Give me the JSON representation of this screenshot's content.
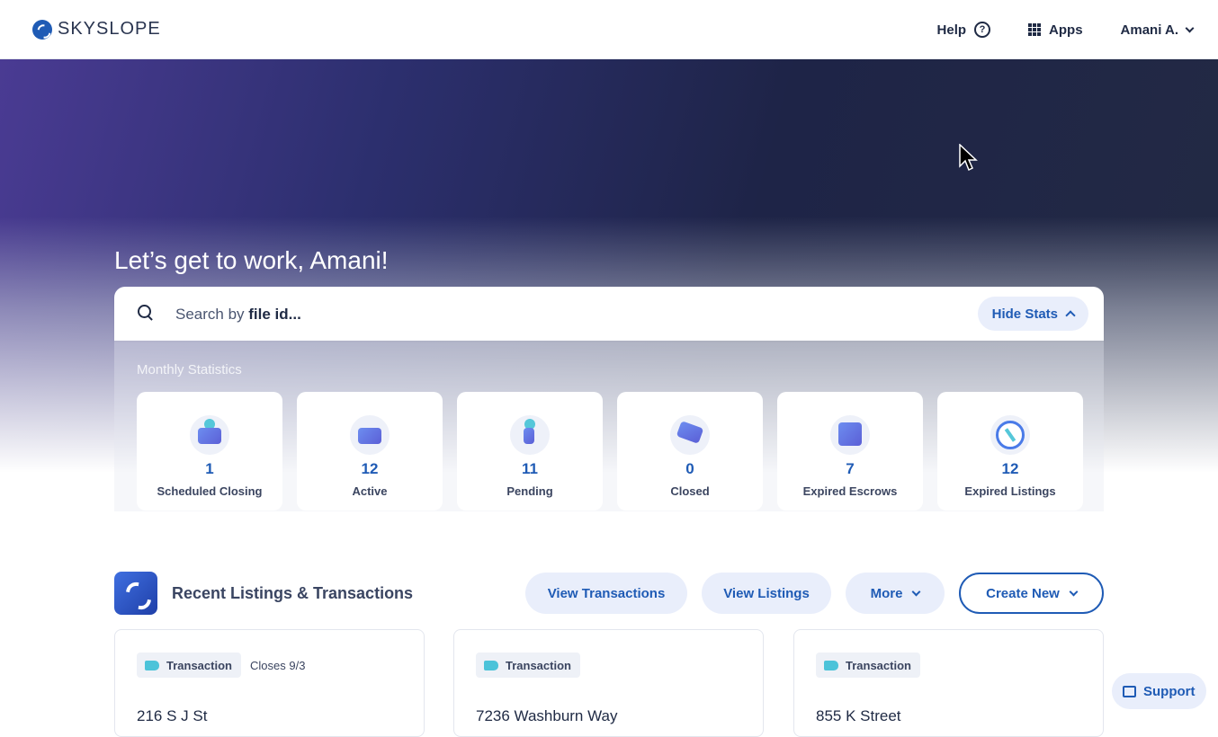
{
  "header": {
    "logo_text": "SKYSLOPE",
    "help_label": "Help",
    "apps_label": "Apps",
    "user_label": "Amani A."
  },
  "hero": {
    "greeting": "Let’s get to work, Amani!"
  },
  "search": {
    "prefix": "Search by ",
    "keyword": "file id...",
    "hide_stats_label": "Hide Stats"
  },
  "stats": {
    "title": "Monthly Statistics",
    "items": [
      {
        "value": "1",
        "label": "Scheduled Closing",
        "icon": "closing-sign-icon"
      },
      {
        "value": "12",
        "label": "Active",
        "icon": "briefcase-icon"
      },
      {
        "value": "11",
        "label": "Pending",
        "icon": "key-icon"
      },
      {
        "value": "0",
        "label": "Closed",
        "icon": "handshake-icon"
      },
      {
        "value": "7",
        "label": "Expired Escrows",
        "icon": "escrow-search-icon"
      },
      {
        "value": "12",
        "label": "Expired Listings",
        "icon": "compass-icon"
      }
    ]
  },
  "recent": {
    "title": "Recent Listings & Transactions",
    "view_transactions": "View Transactions",
    "view_listings": "View Listings",
    "more": "More",
    "create_new": "Create New",
    "cards": [
      {
        "tag": "Transaction",
        "closes": "Closes 9/3",
        "address": "216 S J St"
      },
      {
        "tag": "Transaction",
        "closes": "",
        "address": "7236 Washburn Way"
      },
      {
        "tag": "Transaction",
        "closes": "",
        "address": "855 K Street"
      }
    ]
  },
  "support_label": "Support"
}
